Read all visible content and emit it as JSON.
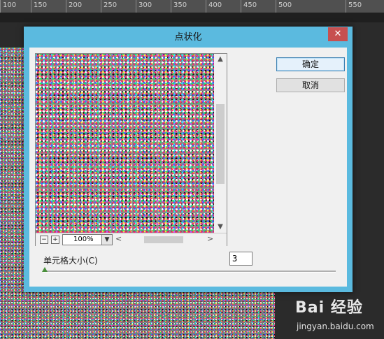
{
  "ruler": {
    "ticks": [
      "100",
      "150",
      "200",
      "250",
      "300",
      "350",
      "400",
      "450",
      "500",
      "550"
    ]
  },
  "dialog": {
    "title": "点状化",
    "close_label": "✕",
    "ok_label": "确定",
    "cancel_label": "取消"
  },
  "preview": {
    "zoom_out": "−",
    "zoom_in": "+",
    "zoom_value": "100%",
    "scroll_up": "▲",
    "scroll_down": "▼",
    "scroll_left": "<",
    "scroll_right": ">"
  },
  "cell_size": {
    "label": "单元格大小(C)",
    "value": "3"
  },
  "watermark": {
    "brand": "Bai 经验",
    "url": "jingyan.baidu.com"
  },
  "colors": {
    "title_bar": "#5bbadf",
    "close": "#c75050",
    "dialog_bg": "#f0f0f0"
  }
}
